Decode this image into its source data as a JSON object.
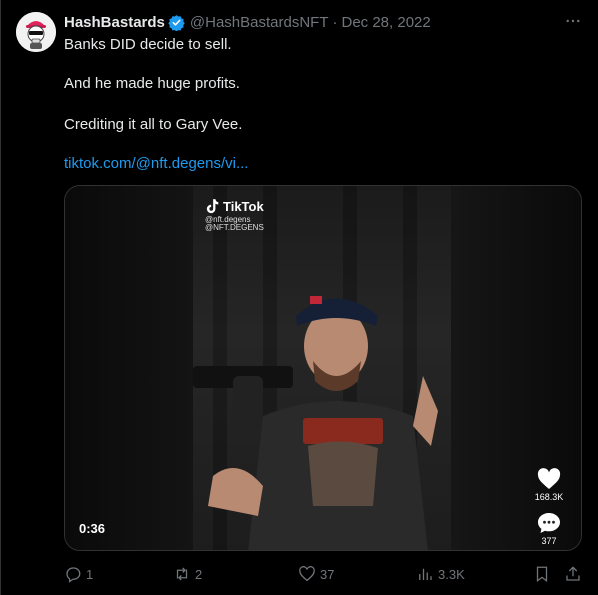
{
  "tweet": {
    "author_name": "HashBastards",
    "handle": "@HashBastardsNFT",
    "separator": "·",
    "date": "Dec 28, 2022",
    "more_icon": "more-horizontal-icon",
    "text_lines": [
      "Banks DID decide to sell.",
      "And he made huge profits.",
      "Crediting it all to Gary Vee."
    ],
    "link_text": "tiktok.com/@nft.degens/vi..."
  },
  "media": {
    "brand": "TikTok",
    "username_line1": "@nft.degens",
    "username_line2": "@NFT.DEGENS",
    "duration": "0:36",
    "likes": "168.3K",
    "comments": "377"
  },
  "actions": {
    "replies": "1",
    "retweets": "2",
    "likes": "37",
    "views": "3.3K"
  },
  "colors": {
    "background": "#000000",
    "text": "#e7e9ea",
    "muted": "#71767b",
    "link": "#1d9bf0",
    "verified": "#1d9bf0",
    "border": "#2f3336"
  }
}
